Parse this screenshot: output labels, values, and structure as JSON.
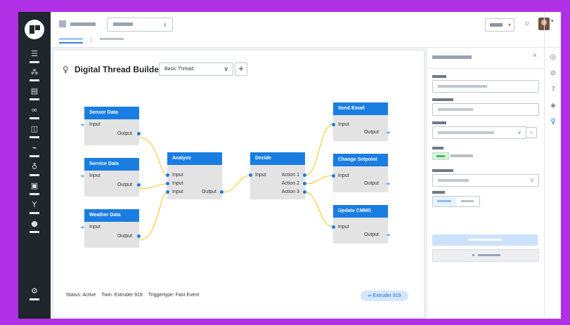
{
  "canvas": {
    "title": "Digital Thread Builder",
    "thread_select": "Basic Thread",
    "add_label": "+",
    "nodes": [
      {
        "title": "Sensor Data",
        "in": [
          "Input"
        ],
        "out": [
          "Output"
        ]
      },
      {
        "title": "Service Data",
        "in": [
          "Input"
        ],
        "out": [
          "Output"
        ]
      },
      {
        "title": "Weather Data",
        "in": [
          "Input"
        ],
        "out": [
          "Output"
        ]
      },
      {
        "title": "Analyse",
        "in": [
          "Input",
          "Input",
          "Input"
        ],
        "out": [
          "Output"
        ]
      },
      {
        "title": "Decide",
        "in": [
          "Input"
        ],
        "out": [
          "Action 1",
          "Action 2",
          "Action 3"
        ]
      },
      {
        "title": "Send Email",
        "in": [
          "Input"
        ],
        "out": [
          "Output"
        ]
      },
      {
        "title": "Change Setpoint",
        "in": [
          "Input"
        ],
        "out": [
          "Output"
        ]
      },
      {
        "title": "Update CMMS",
        "in": [
          "Input"
        ],
        "out": [
          "Output"
        ]
      }
    ]
  },
  "status": {
    "state": "Status: Active",
    "twin": "Twin: Extruder 919",
    "trigger": "Triggertype: Fast Event",
    "badge": "Extruder 919"
  },
  "panel": {
    "close": "×"
  },
  "icons": {
    "rail": [
      "list-icon",
      "hierarchy-icon",
      "database-icon",
      "link-icon",
      "assets-icon",
      "chart-icon",
      "bulb-icon",
      "store-icon",
      "branch-icon",
      "globe-icon"
    ],
    "rail_bottom": "settings-icon",
    "strip": [
      "bot-icon",
      "compass-icon",
      "help-icon",
      "layers-icon",
      "bulb-icon"
    ]
  },
  "colors": {
    "accent": "#1a7de2",
    "wire": "#f3cf3c",
    "rail": "#1f262d",
    "frame": "#b030e6"
  }
}
